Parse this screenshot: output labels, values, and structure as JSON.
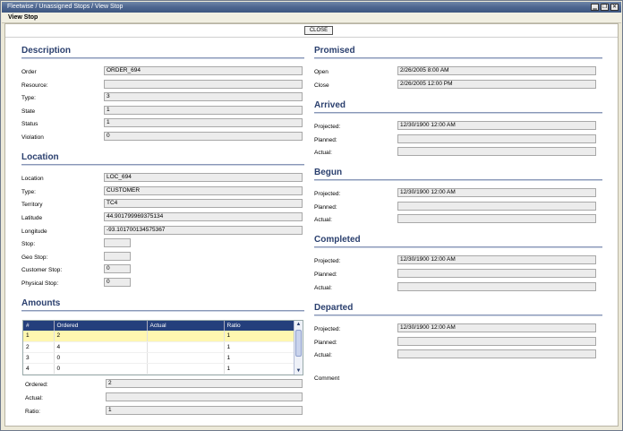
{
  "window": {
    "title": "Fleetwise / Unassigned Stops / View Stop",
    "buttons": {
      "minimize": "▁",
      "restore": "❐",
      "close": "✕"
    }
  },
  "subbar": {
    "label": "View Stop"
  },
  "toolbar": {
    "close_label": "CLOSE"
  },
  "description": {
    "title": "Description",
    "fields": [
      {
        "label": "Order",
        "value": "ORDER_694"
      },
      {
        "label": "Resource:",
        "value": ""
      },
      {
        "label": "Type:",
        "value": "3"
      },
      {
        "label": "State",
        "value": "1"
      },
      {
        "label": "Status",
        "value": "1"
      },
      {
        "label": "Violation",
        "value": "0"
      }
    ]
  },
  "location": {
    "title": "Location",
    "fields": [
      {
        "label": "Location",
        "value": "LOC_694"
      },
      {
        "label": "Type:",
        "value": "CUSTOMER"
      },
      {
        "label": "Territory",
        "value": "TC4"
      },
      {
        "label": "Latitude",
        "value": "44.901799969375134"
      },
      {
        "label": "Longitude",
        "value": "-93.101700134575367"
      },
      {
        "label": "Stop:",
        "value": ""
      },
      {
        "label": "Geo Stop:",
        "value": ""
      },
      {
        "label": "Customer Stop:",
        "value": "0"
      },
      {
        "label": "Physical Stop:",
        "value": "0"
      }
    ]
  },
  "amounts": {
    "title": "Amounts",
    "columns": [
      "#",
      "Ordered",
      "Actual",
      "Ratio"
    ],
    "rows": [
      [
        "1",
        "2",
        "",
        "1"
      ],
      [
        "2",
        "4",
        "",
        "1"
      ],
      [
        "3",
        "0",
        "",
        "1"
      ],
      [
        "4",
        "0",
        "",
        "1"
      ]
    ],
    "fields": [
      {
        "label": "Ordered:",
        "value": "2"
      },
      {
        "label": "Actual:",
        "value": ""
      },
      {
        "label": "Ratio:",
        "value": "1"
      }
    ]
  },
  "promised": {
    "title": "Promised",
    "fields": [
      {
        "label": "Open",
        "value": "2/26/2005 8:00 AM"
      },
      {
        "label": "Close",
        "value": "2/26/2005 12:00 PM"
      }
    ]
  },
  "arrived": {
    "title": "Arrived",
    "fields": [
      {
        "label": "Projected:",
        "value": "12/30/1900 12:00 AM"
      },
      {
        "label": "Planned:",
        "value": ""
      },
      {
        "label": "Actual:",
        "value": ""
      }
    ]
  },
  "begun": {
    "title": "Begun",
    "fields": [
      {
        "label": "Projected:",
        "value": "12/30/1900 12:00 AM"
      },
      {
        "label": "Planned:",
        "value": ""
      },
      {
        "label": "Actual:",
        "value": ""
      }
    ]
  },
  "completed": {
    "title": "Completed",
    "fields": [
      {
        "label": "Projected:",
        "value": "12/30/1900 12:00 AM"
      },
      {
        "label": "Planned:",
        "value": ""
      },
      {
        "label": "Actual:",
        "value": ""
      }
    ]
  },
  "departed": {
    "title": "Departed",
    "fields": [
      {
        "label": "Projected:",
        "value": "12/30/1900 12:00 AM"
      },
      {
        "label": "Planned:",
        "value": ""
      },
      {
        "label": "Actual:",
        "value": ""
      }
    ]
  },
  "comment": {
    "label": "Comment"
  },
  "colors": {
    "title_bar": "#4d6690",
    "section_title": "#2a3f6e",
    "grid_header": "#243f7c",
    "selected_row": "#fff7b0"
  }
}
